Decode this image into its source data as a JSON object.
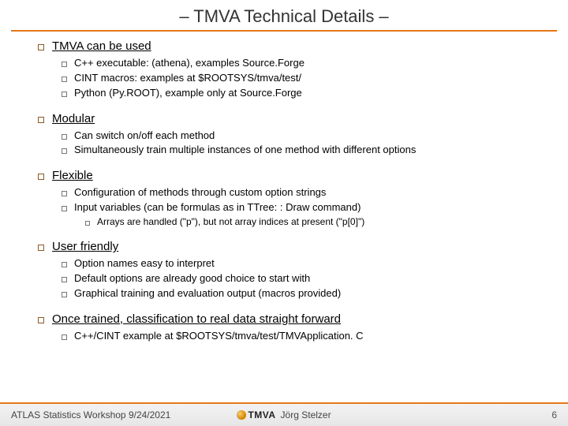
{
  "title": "– TMVA Technical Details –",
  "sections": [
    {
      "heading": "TMVA can be used",
      "underline": true,
      "items": [
        "C++ executable: (athena), examples Source.Forge",
        "CINT macros: examples at $ROOTSYS/tmva/test/",
        "Python (Py.ROOT), example only at Source.Forge"
      ]
    },
    {
      "heading": "Modular",
      "underline": true,
      "items": [
        "Can switch on/off each method",
        "Simultaneously train multiple instances of one method with different options"
      ]
    },
    {
      "heading": "Flexible",
      "underline": true,
      "items": [
        "Configuration of methods through custom option strings",
        "Input variables (can be formulas as in TTree: : Draw command)"
      ],
      "subitems": [
        "Arrays are handled (\"p\"), but not array indices at present (\"p[0]\")"
      ]
    },
    {
      "heading": "User friendly",
      "underline": true,
      "items": [
        "Option names easy to interpret",
        "Default options are already good choice to start with",
        "Graphical training and evaluation output (macros provided)"
      ]
    },
    {
      "heading": "Once trained, classification to real data straight forward",
      "underline": true,
      "items": [
        "C++/CINT example at $ROOTSYS/tmva/test/TMVApplication. C"
      ]
    }
  ],
  "footer": {
    "left": "ATLAS Statistics Workshop 9/24/2021",
    "logo_text": "TMVA",
    "author": "Jörg Stelzer",
    "page": "6"
  }
}
